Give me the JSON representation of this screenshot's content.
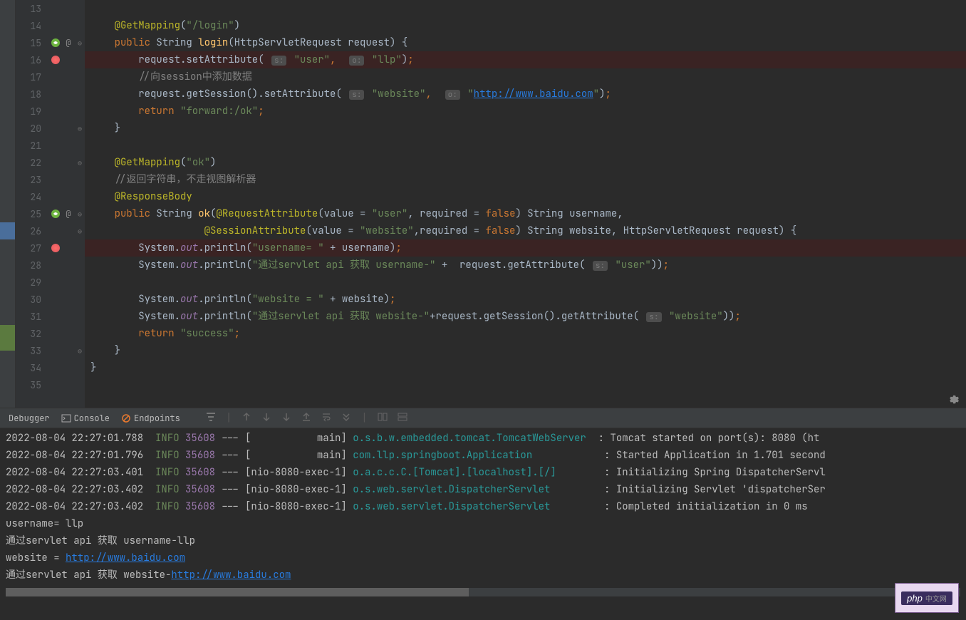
{
  "editor": {
    "startLine": 13,
    "endLine": 35,
    "breakpointLines": [
      16,
      27
    ],
    "springIconLines": [
      15,
      25
    ],
    "atIconLines": [
      15,
      25
    ],
    "foldableLines": [
      15,
      22,
      25,
      26,
      33,
      20
    ],
    "code": {
      "l14_ann": "@GetMapping",
      "l14_path": "\"/login\"",
      "l15_kw": "public",
      "l15_type": " String ",
      "l15_method": "login",
      "l15_params": "(HttpServletRequest request) {",
      "l16_obj": "        request.setAttribute(",
      "l16_hint_s": "s:",
      "l16_str1": "\"user\"",
      "l16_comma": ", ",
      "l16_hint_o": "o:",
      "l16_str2": "\"llp\"",
      "l16_end": ");",
      "l17_comment": "        //向session中添加数据",
      "l18_obj": "        request.getSession().setAttribute(",
      "l18_hint_s": "s:",
      "l18_str1": "\"website\"",
      "l18_comma": ", ",
      "l18_hint_o": "o:",
      "l18_quote": "\"",
      "l18_link": "http://www.baidu.com",
      "l18_end": "\");",
      "l19_kw": "return",
      "l19_str": " \"forward:/ok\"",
      "l19_end": ";",
      "l20_brace": "    }",
      "l22_ann": "@GetMapping",
      "l22_path": "\"ok\"",
      "l23_comment": "    //返回字符串，不走视图解析器",
      "l24_ann": "@ResponseBody",
      "l25_kw": "public",
      "l25_type": " String ",
      "l25_method": "ok",
      "l25_ann": "@RequestAttribute",
      "l25_val": "(value = ",
      "l25_str": "\"user\"",
      "l25_comma": ", required = ",
      "l25_false": "false",
      "l25_end": ") String username,",
      "l26_indent": "                   ",
      "l26_ann": "@SessionAttribute",
      "l26_val": "(value = ",
      "l26_str": "\"website\"",
      "l26_comma": ",required = ",
      "l26_false": "false",
      "l26_end": ") String website, HttpServletRequest request) {",
      "l27_obj": "        System.",
      "l27_out": "out",
      "l27_print": ".println(",
      "l27_str": "\"username= \"",
      "l27_plus": " + username)",
      "l27_end": ";",
      "l28_obj": "        System.",
      "l28_out": "out",
      "l28_print": ".println(",
      "l28_str": "\"通过servlet api 获取 username-\"",
      "l28_plus": " +  request.getAttribute(",
      "l28_hint_s": "s:",
      "l28_str2": "\"user\"",
      "l28_end": "));",
      "l30_obj": "        System.",
      "l30_out": "out",
      "l30_print": ".println(",
      "l30_str": "\"website = \"",
      "l30_plus": " + website)",
      "l30_end": ";",
      "l31_obj": "        System.",
      "l31_out": "out",
      "l31_print": ".println(",
      "l31_str": "\"通过servlet api 获取 website-\"",
      "l31_plus": "+request.getSession().getAttribute(",
      "l31_hint_s": "s:",
      "l31_str2": "\"website\"",
      "l31_end": "));",
      "l32_kw": "return",
      "l32_str": " \"success\"",
      "l32_end": ";",
      "l33_brace": "    }",
      "l34_brace": "}"
    }
  },
  "panel": {
    "tabs": {
      "debugger": "Debugger",
      "console": "Console",
      "endpoints": "Endpoints"
    },
    "console": {
      "lines": [
        {
          "ts": "2022-08-04 22:27:01.788",
          "lvl": "INFO",
          "pid": "35608",
          "thread": "---",
          "brkt": "[           main]",
          "logger": "o.s.b.w.embedded.tomcat.TomcatWebServer",
          "sep": "  :",
          "msg": " Tomcat started on port(s): 8080 (ht"
        },
        {
          "ts": "2022-08-04 22:27:01.796",
          "lvl": "INFO",
          "pid": "35608",
          "thread": "---",
          "brkt": "[           main]",
          "logger": "com.llp.springboot.Application",
          "pad": "          ",
          "sep": "  :",
          "msg": " Started Application in 1.701 second"
        },
        {
          "ts": "2022-08-04 22:27:03.401",
          "lvl": "INFO",
          "pid": "35608",
          "thread": "---",
          "brkt": "[nio-8080-exec-1]",
          "logger": "o.a.c.c.C.[Tomcat].[localhost].[/]",
          "pad": "      ",
          "sep": "  :",
          "msg": " Initializing Spring DispatcherServl"
        },
        {
          "ts": "2022-08-04 22:27:03.402",
          "lvl": "INFO",
          "pid": "35608",
          "thread": "---",
          "brkt": "[nio-8080-exec-1]",
          "logger": "o.s.web.servlet.DispatcherServlet",
          "pad": "       ",
          "sep": "  :",
          "msg": " Initializing Servlet 'dispatcherSer"
        },
        {
          "ts": "2022-08-04 22:27:03.402",
          "lvl": "INFO",
          "pid": "35608",
          "thread": "---",
          "brkt": "[nio-8080-exec-1]",
          "logger": "o.s.web.servlet.DispatcherServlet",
          "pad": "       ",
          "sep": "  :",
          "msg": " Completed initialization in 0 ms"
        }
      ],
      "output": {
        "l1": "username= llp",
        "l2": "通过servlet api 获取 username-llp",
        "l3_prefix": "website = ",
        "l3_link": "http://www.baidu.com",
        "l4_prefix": "通过servlet api 获取 website-",
        "l4_link": "http://www.baidu.com"
      }
    }
  },
  "badge": {
    "text": "php"
  }
}
